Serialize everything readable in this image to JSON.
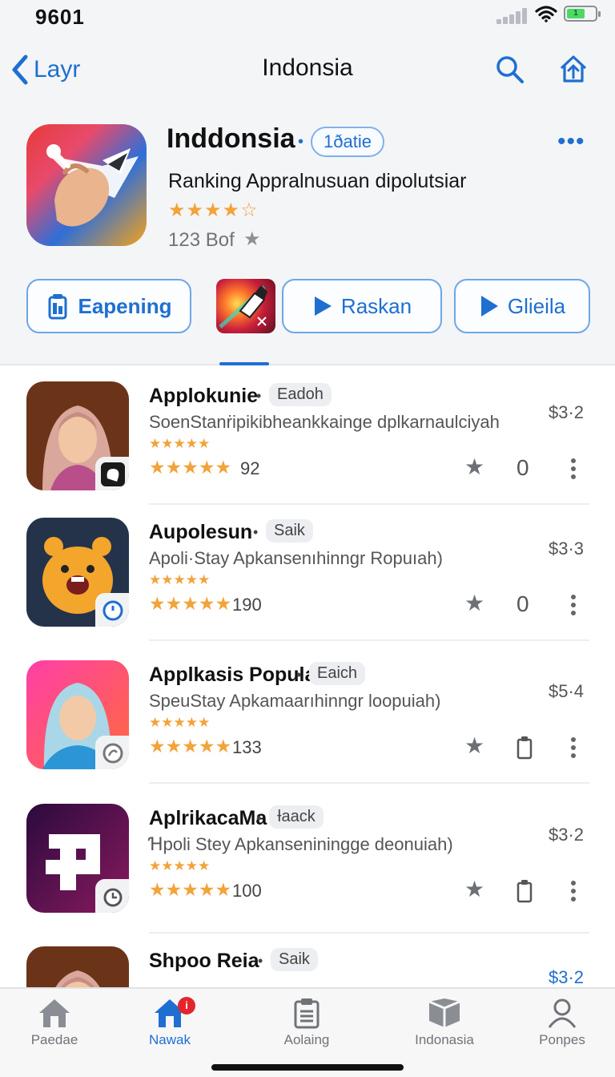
{
  "status_bar": {
    "time": "9601"
  },
  "nav": {
    "back_label": "Layr",
    "title": "Indonsia"
  },
  "hero": {
    "title": "Inddonsia",
    "badge": "1ðatie",
    "subtitle": "Ranking Appralnusuan dipolutsiar",
    "rating_stars": "★★★★☆",
    "review_count": "123 Bof",
    "review_star": "★"
  },
  "actions": [
    {
      "label": "Eapening",
      "icon": "device-icon"
    },
    {
      "label": "Raskan",
      "icon": "play-icon"
    },
    {
      "label": "Glieila",
      "icon": "play-icon"
    }
  ],
  "apps": [
    {
      "name": "Applokunie",
      "tag": "Eadoh",
      "description": "SoenStanṙipikibheankkainge dplkarnaulciyah",
      "small_stars": "★★★★★",
      "stars": "★★★★★",
      "count": "92",
      "price": "$3·2",
      "action": "0",
      "icon": "person-hijab-icon",
      "colors": [
        "#6b3418",
        "#c07a3c"
      ]
    },
    {
      "name": "Aupolesun",
      "tag": "Saik",
      "description": "Apoli·Stay Apkansenıhinngr Ropuıah)",
      "small_stars": "★★★★★",
      "stars": "★★★★★",
      "count": "190",
      "price": "$3·3",
      "action": "0",
      "icon": "bear-mascot-icon",
      "colors": [
        "#24334a",
        "#f3a52c"
      ]
    },
    {
      "name": "Applkasis Popula",
      "tag": "Eaich",
      "description": "SpeuStay Apkamaarıhinngr loopuiah)",
      "small_stars": "★★★★★",
      "stars": "★★★★★",
      "count": "133",
      "price": "$5·4",
      "action": "clip",
      "icon": "person-blue-hijab-icon",
      "colors": [
        "#ff3fa8",
        "#ff6a3d"
      ]
    },
    {
      "name": "AplrikacaMa",
      "tag": "Ɨaack",
      "description": "Ɦpoli Stey Apkanseniningge deonuiah)",
      "small_stars": "★★★★★",
      "stars": "★★★★★",
      "count": "100",
      "price": "$3·2",
      "action": "clip",
      "icon": "letter-p-icon",
      "colors": [
        "#2a0a3e",
        "#8a1a5e"
      ]
    },
    {
      "name": "Shpoo Reia",
      "tag": "Saik",
      "description": "",
      "small_stars": "",
      "stars": "",
      "count": "",
      "price": "$3·2",
      "action": "",
      "icon": "person-hijab-icon",
      "colors": [
        "#6b3418",
        "#c07a3c"
      ]
    }
  ],
  "tabs": [
    {
      "label": "Paedae",
      "icon": "house-icon"
    },
    {
      "label": "Nawak",
      "icon": "store-icon",
      "badge": "i"
    },
    {
      "label": "Aolaing",
      "icon": "clipboard-icon"
    },
    {
      "label": "Indonasia",
      "icon": "box-icon"
    },
    {
      "label": "Ponpes",
      "icon": "person-icon"
    }
  ],
  "theme": {
    "accent": "#1f6fd1",
    "star": "#f2a33a",
    "badge_red": "#e5252d"
  }
}
